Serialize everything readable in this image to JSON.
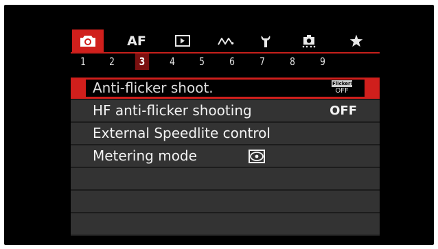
{
  "tabs": [
    {
      "icon": "camera-icon",
      "active": true
    },
    {
      "label": "AF",
      "icon": "af-icon"
    },
    {
      "icon": "playback-icon"
    },
    {
      "icon": "wireless-icon"
    },
    {
      "icon": "wrench-icon"
    },
    {
      "icon": "custom-function-icon"
    },
    {
      "icon": "star-icon"
    }
  ],
  "pages": [
    "1",
    "2",
    "3",
    "4",
    "5",
    "6",
    "7",
    "8",
    "9"
  ],
  "active_page": "3",
  "rows": [
    {
      "label": "Anti-flicker shoot.",
      "value_icon": "flicker-icon",
      "icon_text_top": "Flicker!",
      "icon_text_bottom": "OFF",
      "selected": true
    },
    {
      "label": "HF anti-flicker shooting",
      "value": "OFF"
    },
    {
      "label": "External Speedlite control",
      "value": ""
    },
    {
      "label": "Metering mode",
      "value_icon": "evaluative-metering-icon"
    },
    {
      "label": ""
    },
    {
      "label": ""
    },
    {
      "label": ""
    }
  ],
  "colors": {
    "accent_red": "#d01f1c",
    "row_bg": "#333333",
    "page_active_bg": "#7a1010",
    "frame_bg": "#000000"
  }
}
